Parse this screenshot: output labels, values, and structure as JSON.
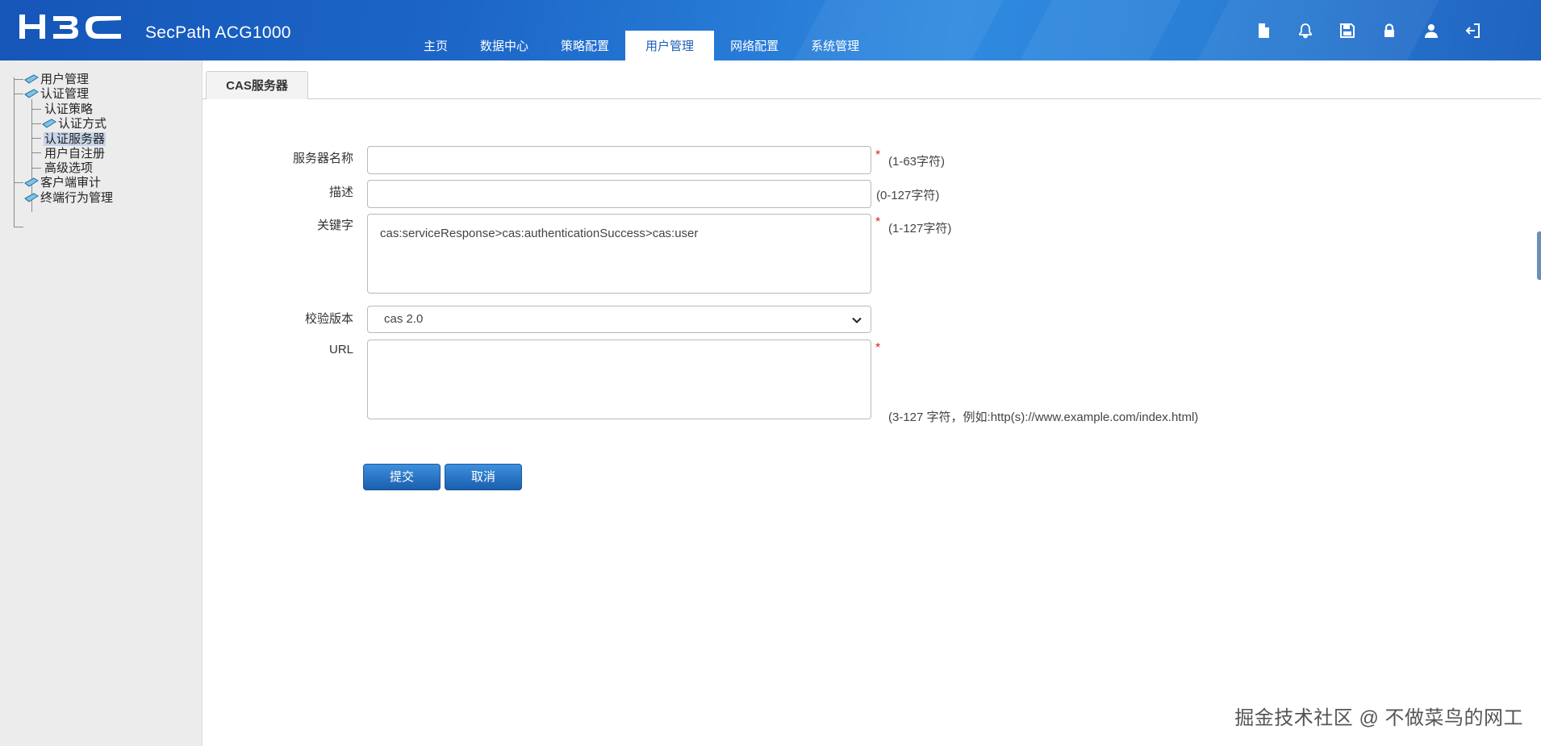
{
  "brand": {
    "logo": "H3C",
    "product": "SecPath ACG1000"
  },
  "nav": {
    "items": [
      "主页",
      "数据中心",
      "策略配置",
      "用户管理",
      "网络配置",
      "系统管理"
    ],
    "active_index": 3
  },
  "header_icons": [
    "document-icon",
    "bell-icon",
    "save-icon",
    "lock-icon",
    "user-icon",
    "logout-icon"
  ],
  "sidebar": {
    "tree": [
      {
        "label": "用户管理",
        "level": 0,
        "icon": "book-icon"
      },
      {
        "label": "认证管理",
        "level": 0,
        "icon": "book-icon"
      },
      {
        "label": "认证策略",
        "level": 1
      },
      {
        "label": "认证方式",
        "level": 1,
        "icon": "book-icon"
      },
      {
        "label": "认证服务器",
        "level": 1,
        "selected": true
      },
      {
        "label": "用户自注册",
        "level": 1
      },
      {
        "label": "高级选项",
        "level": 1
      },
      {
        "label": "客户端审计",
        "level": 0,
        "icon": "book-icon"
      },
      {
        "label": "终端行为管理",
        "level": 0,
        "icon": "book-icon"
      }
    ]
  },
  "tab": {
    "label": "CAS服务器"
  },
  "form": {
    "server_name": {
      "label": "服务器名称",
      "value": "",
      "required": "*",
      "hint": "(1-63字符)"
    },
    "description": {
      "label": "描述",
      "value": "",
      "hint": "(0-127字符)"
    },
    "keyword": {
      "label": "关键字",
      "value": "cas:serviceResponse>cas:authenticationSuccess>cas:user",
      "required": "*",
      "hint": "(1-127字符)"
    },
    "version": {
      "label": "校验版本",
      "value": "cas 2.0"
    },
    "url": {
      "label": "URL",
      "value": "",
      "required": "*",
      "hint": "(3-127 字符，例如:http(s)://www.example.com/index.html)"
    }
  },
  "buttons": {
    "submit": "提交",
    "cancel": "取消"
  },
  "watermark": "掘金技术社区 @ 不做菜鸟的网工",
  "colors": {
    "header": "#1d5fb7",
    "button": "#1a5fae",
    "required": "#e02020",
    "sidebar_bg": "#ececec"
  }
}
